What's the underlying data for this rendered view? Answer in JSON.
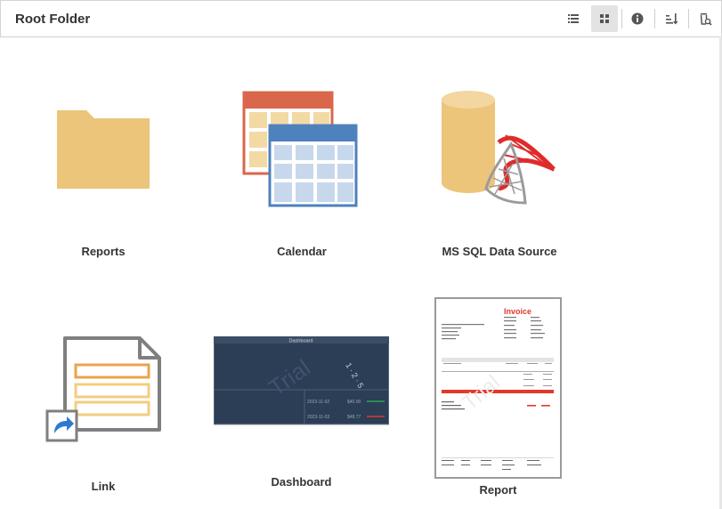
{
  "header": {
    "title": "Root Folder",
    "toolbar": [
      {
        "name": "list-view-icon"
      },
      {
        "name": "grid-view-icon",
        "active": true
      },
      {
        "name": "info-icon"
      },
      {
        "name": "sort-icon"
      },
      {
        "name": "recycle-bin-icon"
      }
    ]
  },
  "items": [
    {
      "label": "Reports",
      "icon": "folder-icon"
    },
    {
      "label": "Calendar",
      "icon": "calendar-table-icon"
    },
    {
      "label": "MS SQL Data Source",
      "icon": "mssql-database-icon"
    },
    {
      "label": "Link",
      "icon": "link-document-icon"
    },
    {
      "label": "Dashboard",
      "icon": "dashboard-thumbnail"
    },
    {
      "label": "Report",
      "icon": "report-thumbnail"
    }
  ],
  "thumbnails": {
    "dashboard": {
      "header": "Dashboard",
      "watermark": "Trial",
      "rows": [
        {
          "date": "2023-11-02",
          "value": "$40.00"
        },
        {
          "date": "2023-11-03",
          "value": "$48.77"
        }
      ]
    },
    "report": {
      "title": "Invoice",
      "watermark": "Trial"
    }
  },
  "colors": {
    "folder": "#ecc47a",
    "calendar_back": "#d9674b",
    "calendar_front": "#4f81bd",
    "database": "#ecc47a",
    "sql_red": "#e02b2b",
    "link_bars": "#eba34d",
    "dashboard_bg": "#2b3e55",
    "invoice_red": "#e0392b"
  }
}
